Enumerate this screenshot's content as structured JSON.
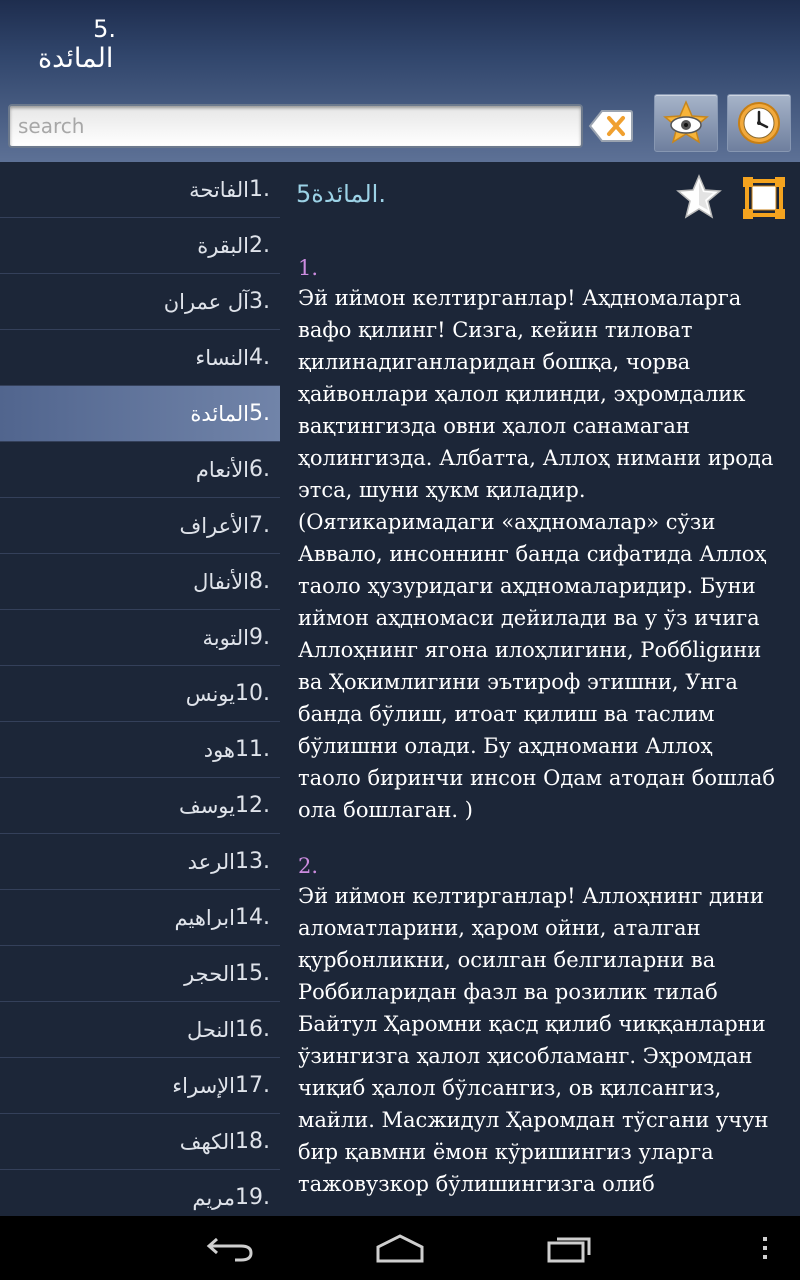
{
  "header": {
    "title_number": "5.",
    "title_name": "المائدة",
    "search_placeholder": "search"
  },
  "sidebar": {
    "items": [
      {
        "num": "1.",
        "name": "الفاتحة",
        "selected": false
      },
      {
        "num": "2.",
        "name": "البقرة",
        "selected": false
      },
      {
        "num": "3.",
        "name": "آل عمران",
        "selected": false
      },
      {
        "num": "4.",
        "name": "النساء",
        "selected": false
      },
      {
        "num": "5.",
        "name": "المائدة",
        "selected": true
      },
      {
        "num": "6.",
        "name": "الأنعام",
        "selected": false
      },
      {
        "num": "7.",
        "name": "الأعراف",
        "selected": false
      },
      {
        "num": "8.",
        "name": "الأنفال",
        "selected": false
      },
      {
        "num": "9.",
        "name": "التوبة",
        "selected": false
      },
      {
        "num": "10.",
        "name": "يونس",
        "selected": false
      },
      {
        "num": "11.",
        "name": "هود",
        "selected": false
      },
      {
        "num": "12.",
        "name": "يوسف",
        "selected": false
      },
      {
        "num": "13.",
        "name": "الرعد",
        "selected": false
      },
      {
        "num": "14.",
        "name": "ابراهيم",
        "selected": false
      },
      {
        "num": "15.",
        "name": "الحجر",
        "selected": false
      },
      {
        "num": "16.",
        "name": "النحل",
        "selected": false
      },
      {
        "num": "17.",
        "name": "الإسراء",
        "selected": false
      },
      {
        "num": "18.",
        "name": "الكهف",
        "selected": false
      },
      {
        "num": "19.",
        "name": "مريم",
        "selected": false
      }
    ]
  },
  "content": {
    "title_number": "5.",
    "title_name": "المائدة",
    "verses": [
      {
        "number": "1.",
        "text": "Эй иймон келтирганлар! Аҳдномаларга вафо қилинг! Сизга, кейин тиловат қилинадиганларидан бошқа, чорва ҳайвонлари ҳалол қилинди, эҳромдалик вақтингизда овни ҳалол санамаган ҳолингизда. Албатта, Аллоҳ нимани ирода этса, шуни ҳукм қиладир. (Оятикаримадаги «аҳдномалар» сўзи Аввало, инсоннинг банда сифатида Аллоҳ таоло ҳузуридаги аҳдномаларидир. Буни иймон аҳдномаси дейилади ва у ўз ичига Аллоҳнинг ягона илоҳлигини, Роббligини ва Ҳокимлигини эътироф этишни, Унга банда бўлиш, итоат қилиш ва таслим бўлишни олади. Бу аҳдномани Аллоҳ таоло биринчи инсон Одам атодан бошлаб ола бошлаган. )"
      },
      {
        "number": "2.",
        "text": "Эй иймон келтирганлар! Аллоҳнинг дини аломатларини, ҳаром ойни, аталган қурбонликни, осилган белгиларни ва Роббиларидан фазл ва розилик тилаб Байтул Ҳаромни қасд қилиб чиққанларни ўзингизга ҳалол ҳисобламанг. Эҳромдан чиқиб ҳалол бўлсангиз, ов қилсангиз, майли. Масжидул Ҳаромдан тўсгани учун бир қавмни ёмон кўришингиз уларга тажовузкор бўлишингизга олиб"
      }
    ]
  },
  "colors": {
    "header_top": "#1e2d4e",
    "header_bottom": "#5d7196",
    "background": "#1c2638",
    "selected_item": "#5f729a",
    "content_title": "#9cd2e6",
    "verse_number": "#cd8ce0",
    "verse_text": "#ffffff"
  },
  "icons": {
    "clear": "backspace-clear-icon",
    "bookmarks": "star-eye-icon",
    "history": "clock-icon",
    "favorite": "star-icon",
    "fullscreen": "fullscreen-icon",
    "back": "back-arrow-icon",
    "home": "home-icon",
    "recents": "recent-apps-icon",
    "menu": "overflow-menu-icon"
  }
}
